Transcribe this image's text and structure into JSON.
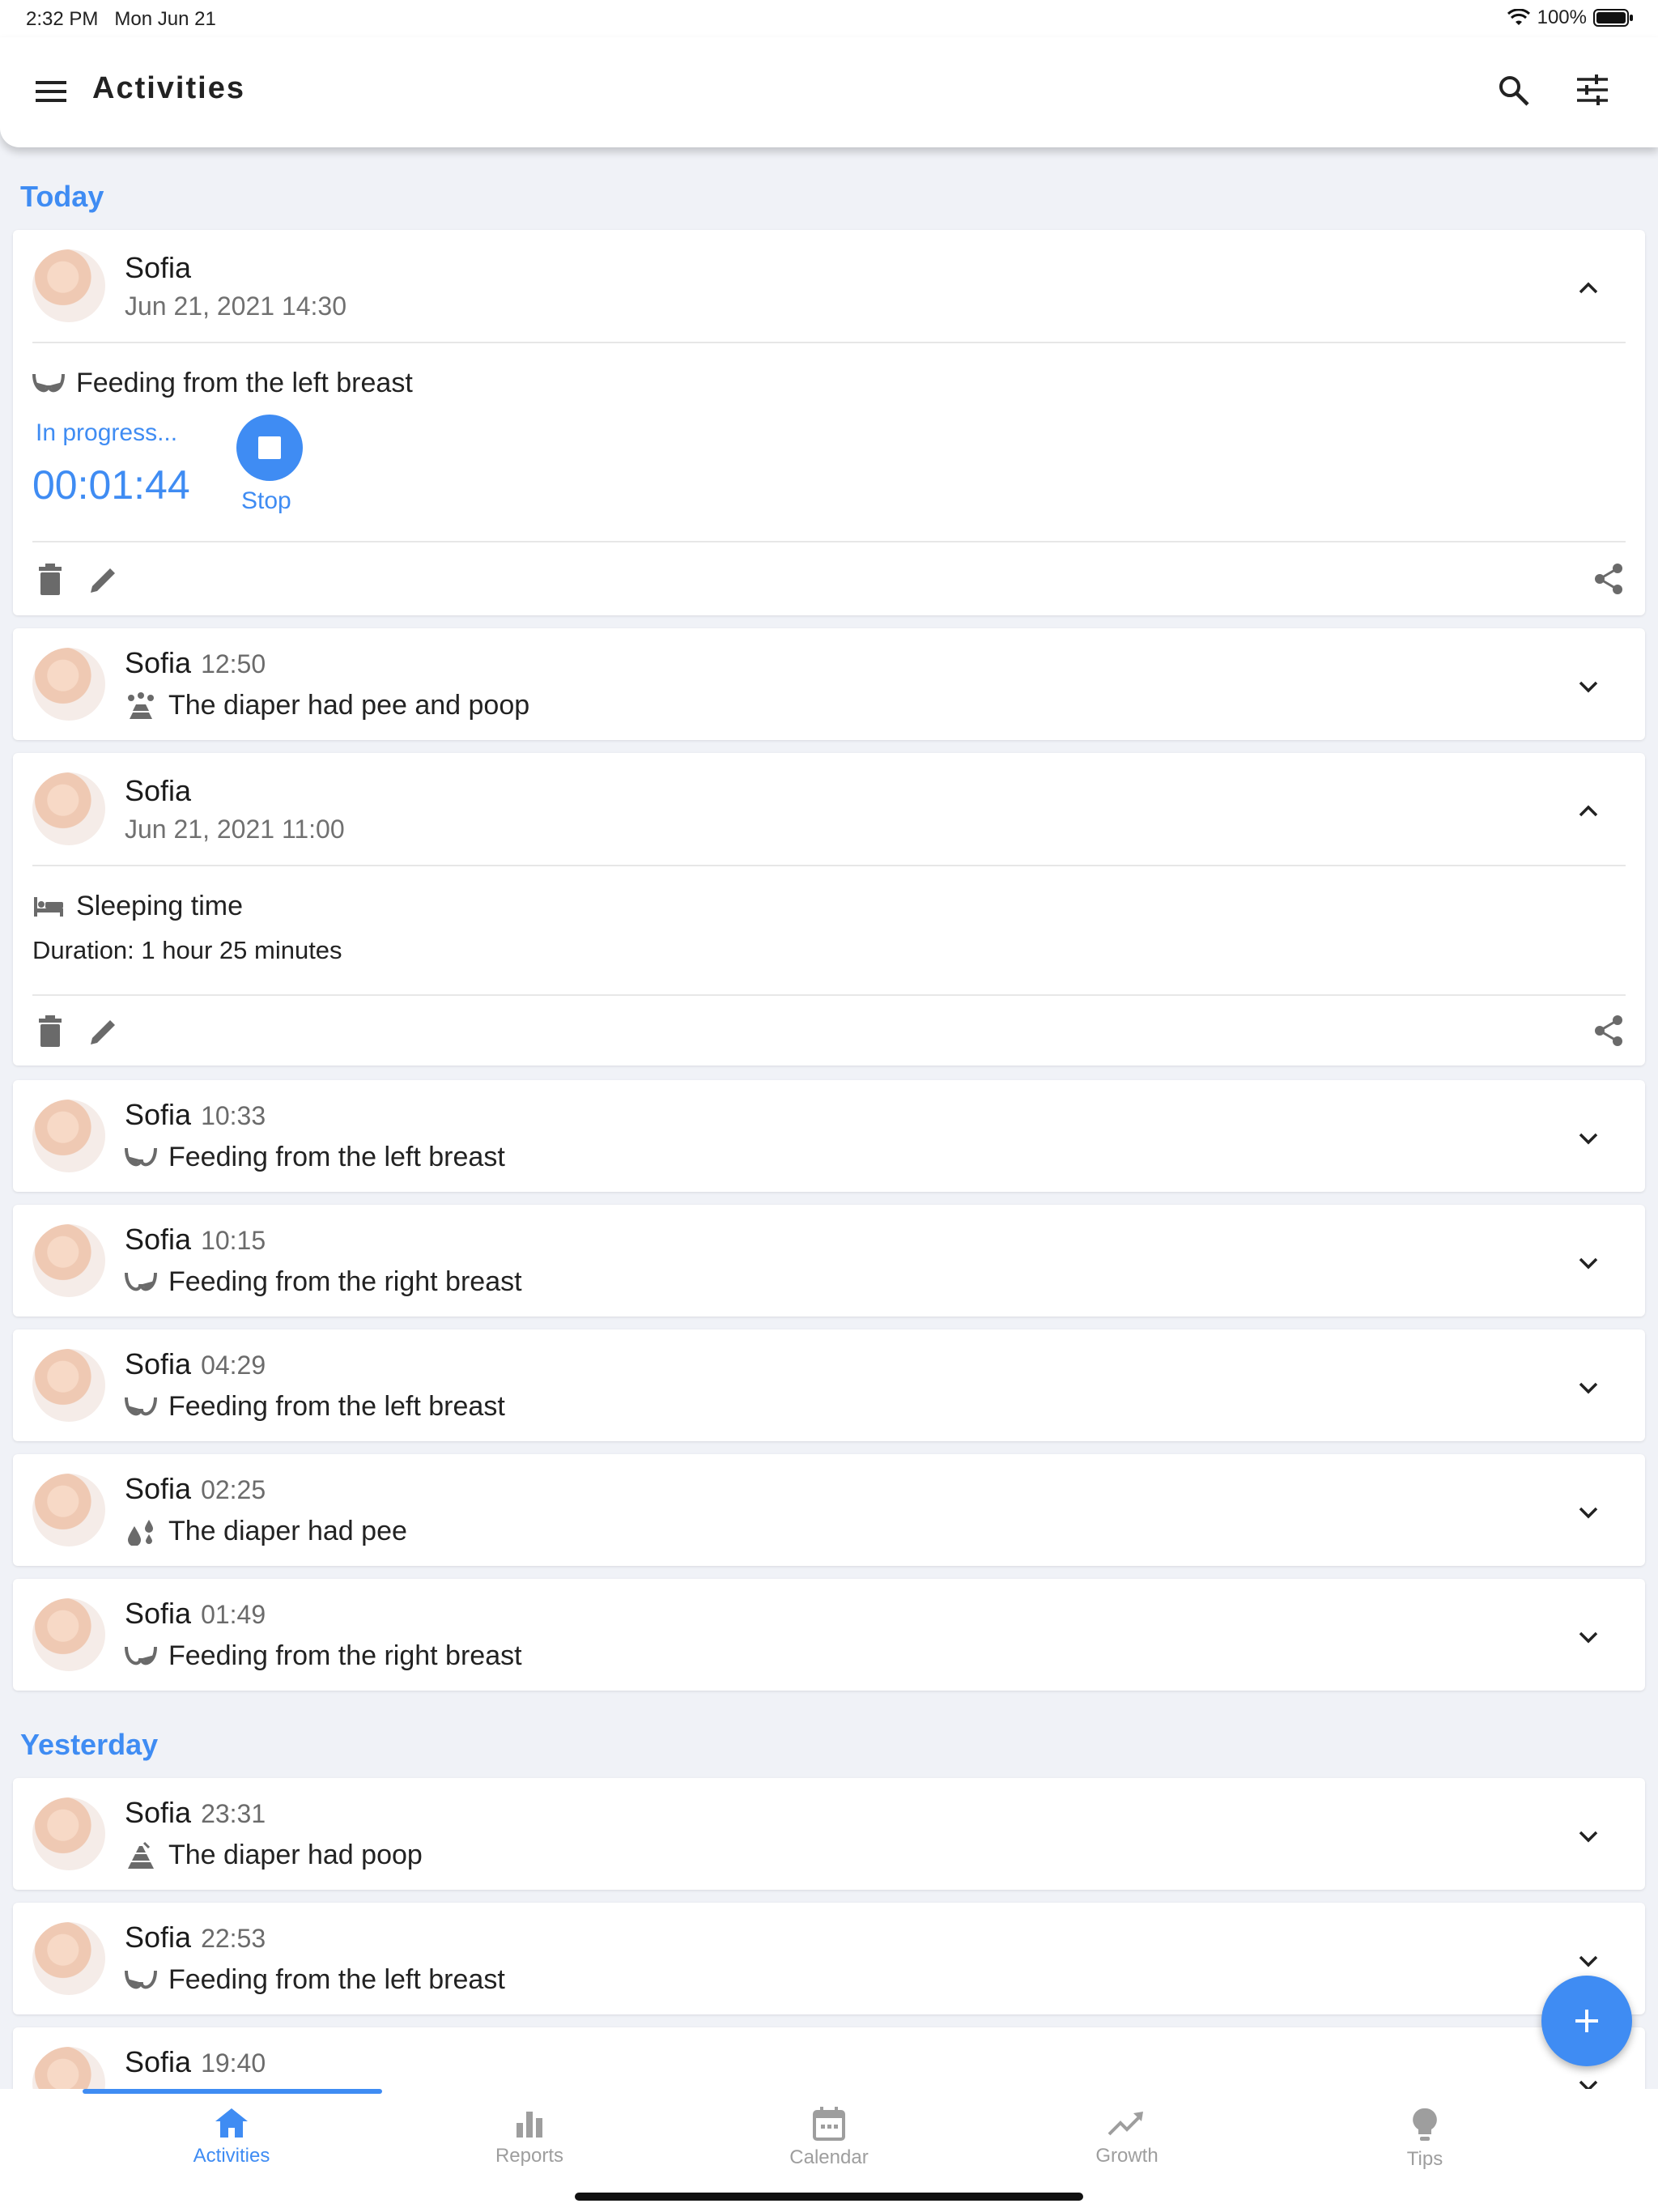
{
  "status": {
    "time": "2:32 PM",
    "date": "Mon Jun 21",
    "battery": "100%"
  },
  "appbar": {
    "title": "Activities"
  },
  "sections": {
    "today": "Today",
    "yesterday": "Yesterday"
  },
  "card1": {
    "name": "Sofia",
    "datetime": "Jun 21, 2021 14:30",
    "activity": "Feeding from the left breast",
    "status": "In progress...",
    "timer": "00:01:44",
    "stop_label": "Stop"
  },
  "card2": {
    "name": "Sofia",
    "time": "12:50",
    "desc": "The diaper had pee and poop"
  },
  "card3": {
    "name": "Sofia",
    "datetime": "Jun 21, 2021 11:00",
    "activity": "Sleeping time",
    "duration": "Duration: 1 hour 25 minutes"
  },
  "rows": [
    {
      "name": "Sofia",
      "time": "10:33",
      "desc": "Feeding from the left breast"
    },
    {
      "name": "Sofia",
      "time": "10:15",
      "desc": "Feeding from the right breast"
    },
    {
      "name": "Sofia",
      "time": "04:29",
      "desc": "Feeding from the left breast"
    },
    {
      "name": "Sofia",
      "time": "02:25",
      "desc": "The diaper had pee"
    },
    {
      "name": "Sofia",
      "time": "01:49",
      "desc": "Feeding from the right breast"
    }
  ],
  "yesterday_rows": [
    {
      "name": "Sofia",
      "time": "23:31",
      "desc": "The diaper had poop"
    },
    {
      "name": "Sofia",
      "time": "22:53",
      "desc": "Feeding from the left breast"
    },
    {
      "name": "Sofia",
      "time": "19:40"
    }
  ],
  "nav": {
    "activities": "Activities",
    "reports": "Reports",
    "calendar": "Calendar",
    "growth": "Growth",
    "tips": "Tips"
  },
  "colors": {
    "accent": "#3f8cf3",
    "background": "#f0f2f7",
    "card": "#ffffff"
  }
}
